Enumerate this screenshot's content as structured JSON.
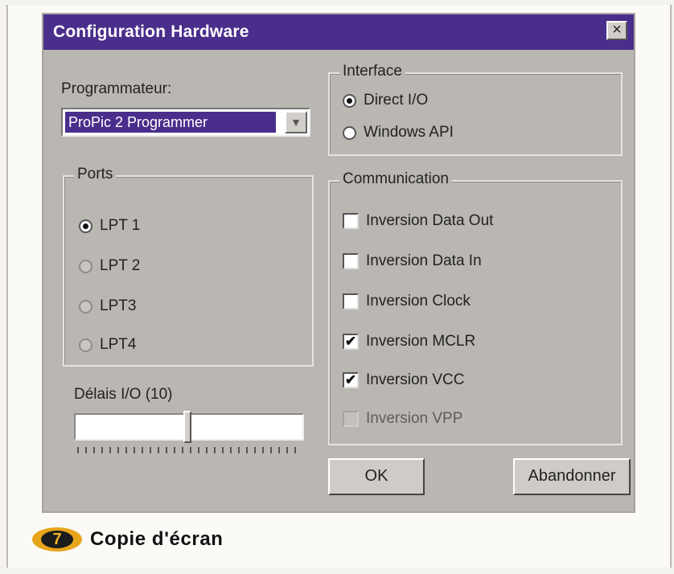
{
  "window": {
    "title": "Configuration Hardware",
    "close_glyph": "×"
  },
  "programmer": {
    "label": "Programmateur:",
    "selected": "ProPic 2 Programmer",
    "arrow": "▼"
  },
  "interface": {
    "title": "Interface",
    "options": [
      "Direct I/O",
      "Windows API"
    ],
    "selected": "Direct I/O"
  },
  "ports": {
    "title": "Ports",
    "options": [
      "LPT 1",
      "LPT 2",
      "LPT3",
      "LPT4"
    ],
    "selected": "LPT 1",
    "enabled": [
      "LPT 1"
    ]
  },
  "communication": {
    "title": "Communication",
    "options": [
      {
        "label": "Inversion Data Out",
        "checked": false,
        "enabled": true
      },
      {
        "label": "Inversion Data In",
        "checked": false,
        "enabled": true
      },
      {
        "label": "Inversion Clock",
        "checked": false,
        "enabled": true
      },
      {
        "label": "Inversion MCLR",
        "checked": true,
        "enabled": true
      },
      {
        "label": "Inversion VCC",
        "checked": true,
        "enabled": true
      },
      {
        "label": "Inversion VPP",
        "checked": false,
        "enabled": false
      }
    ]
  },
  "delay": {
    "label": "Délais I/O  (10)",
    "value": 10
  },
  "buttons": {
    "ok": "OK",
    "cancel": "Abandonner"
  },
  "caption": {
    "number": "7",
    "text": "Copie d'écran"
  },
  "colors": {
    "titlebar": "#4a2e8c",
    "dialog": "#bab7b3",
    "badge": "#e7a51b"
  }
}
